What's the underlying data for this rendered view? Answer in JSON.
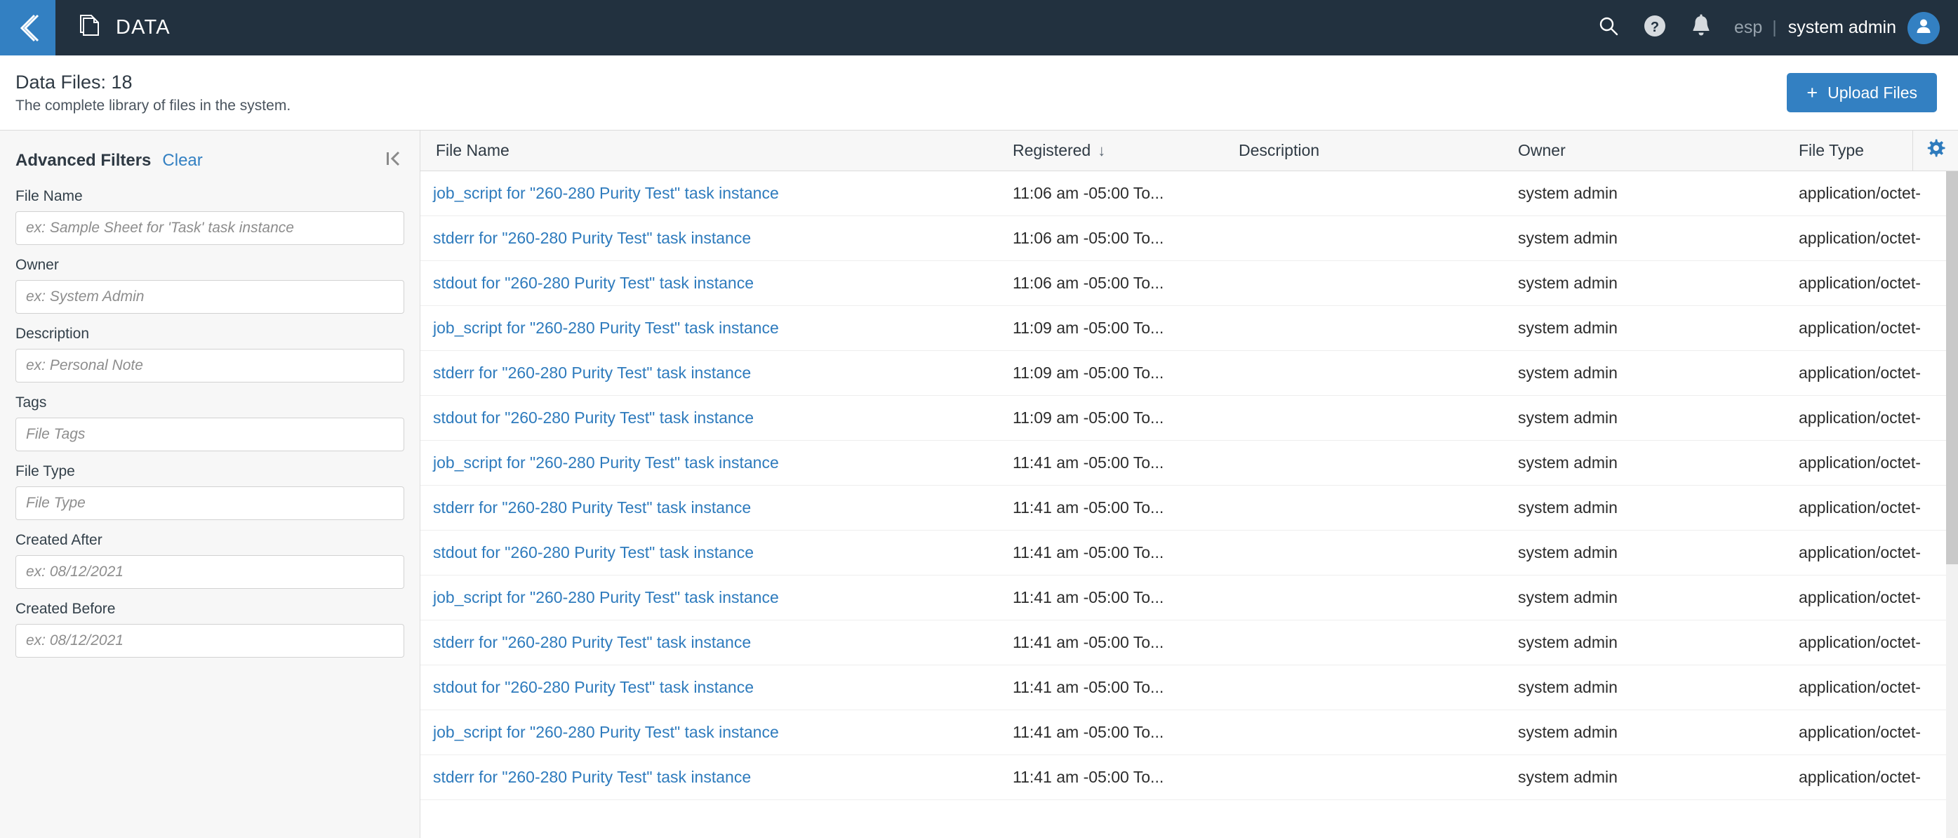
{
  "topnav": {
    "back_icon": "chevron-left-icon",
    "app_icon": "documents-stack-icon",
    "brand": "DATA",
    "search_icon": "search-icon",
    "help_icon": "help-circle-icon",
    "notifications_icon": "bell-icon",
    "tenant": "esp",
    "separator": "|",
    "username": "system admin",
    "avatar_icon": "user-avatar-icon",
    "background_color": "#22313f",
    "accent_color": "#3380c2"
  },
  "subheader": {
    "title": "Data Files: 18",
    "subtitle": "The complete library of files in the system.",
    "upload_button": {
      "plus": "+",
      "label": "Upload Files"
    }
  },
  "filters": {
    "title": "Advanced Filters",
    "clear_label": "Clear",
    "collapse_icon": "collapse-panel-left-icon",
    "fields": [
      {
        "label": "File Name",
        "placeholder": "ex: Sample Sheet for 'Task' task instance",
        "value": ""
      },
      {
        "label": "Owner",
        "placeholder": "ex: System Admin",
        "value": ""
      },
      {
        "label": "Description",
        "placeholder": "ex: Personal Note",
        "value": ""
      },
      {
        "label": "Tags",
        "placeholder": "File Tags",
        "value": ""
      },
      {
        "label": "File Type",
        "placeholder": "File Type",
        "value": ""
      },
      {
        "label": "Created After",
        "placeholder": "ex: 08/12/2021",
        "value": ""
      },
      {
        "label": "Created Before",
        "placeholder": "ex: 08/12/2021",
        "value": ""
      }
    ]
  },
  "table": {
    "columns": [
      {
        "key": "name",
        "label": "File Name",
        "sorted": false
      },
      {
        "key": "registered",
        "label": "Registered",
        "sorted": true,
        "sort_arrow": "↓"
      },
      {
        "key": "description",
        "label": "Description",
        "sorted": false
      },
      {
        "key": "owner",
        "label": "Owner",
        "sorted": false
      },
      {
        "key": "filetype",
        "label": "File Type",
        "sorted": false
      }
    ],
    "settings_icon": "gear-icon",
    "rows": [
      {
        "name": "job_script for \"260-280 Purity Test\" task instance",
        "registered": "11:06 am -05:00 To...",
        "description": "",
        "owner": "system admin",
        "filetype": "application/octet-st..."
      },
      {
        "name": "stderr for \"260-280 Purity Test\" task instance",
        "registered": "11:06 am -05:00 To...",
        "description": "",
        "owner": "system admin",
        "filetype": "application/octet-st..."
      },
      {
        "name": "stdout for \"260-280 Purity Test\" task instance",
        "registered": "11:06 am -05:00 To...",
        "description": "",
        "owner": "system admin",
        "filetype": "application/octet-st..."
      },
      {
        "name": "job_script for \"260-280 Purity Test\" task instance",
        "registered": "11:09 am -05:00 To...",
        "description": "",
        "owner": "system admin",
        "filetype": "application/octet-st..."
      },
      {
        "name": "stderr for \"260-280 Purity Test\" task instance",
        "registered": "11:09 am -05:00 To...",
        "description": "",
        "owner": "system admin",
        "filetype": "application/octet-st..."
      },
      {
        "name": "stdout for \"260-280 Purity Test\" task instance",
        "registered": "11:09 am -05:00 To...",
        "description": "",
        "owner": "system admin",
        "filetype": "application/octet-st..."
      },
      {
        "name": "job_script for \"260-280 Purity Test\" task instance",
        "registered": "11:41 am -05:00 To...",
        "description": "",
        "owner": "system admin",
        "filetype": "application/octet-st..."
      },
      {
        "name": "stderr for \"260-280 Purity Test\" task instance",
        "registered": "11:41 am -05:00 To...",
        "description": "",
        "owner": "system admin",
        "filetype": "application/octet-st..."
      },
      {
        "name": "stdout for \"260-280 Purity Test\" task instance",
        "registered": "11:41 am -05:00 To...",
        "description": "",
        "owner": "system admin",
        "filetype": "application/octet-st..."
      },
      {
        "name": "job_script for \"260-280 Purity Test\" task instance",
        "registered": "11:41 am -05:00 To...",
        "description": "",
        "owner": "system admin",
        "filetype": "application/octet-st..."
      },
      {
        "name": "stderr for \"260-280 Purity Test\" task instance",
        "registered": "11:41 am -05:00 To...",
        "description": "",
        "owner": "system admin",
        "filetype": "application/octet-st..."
      },
      {
        "name": "stdout for \"260-280 Purity Test\" task instance",
        "registered": "11:41 am -05:00 To...",
        "description": "",
        "owner": "system admin",
        "filetype": "application/octet-st..."
      },
      {
        "name": "job_script for \"260-280 Purity Test\" task instance",
        "registered": "11:41 am -05:00 To...",
        "description": "",
        "owner": "system admin",
        "filetype": "application/octet-st..."
      },
      {
        "name": "stderr for \"260-280 Purity Test\" task instance",
        "registered": "11:41 am -05:00 To...",
        "description": "",
        "owner": "system admin",
        "filetype": "application/octet-st..."
      }
    ]
  },
  "colors": {
    "nav_bg": "#22313f",
    "accent": "#3380c2",
    "link": "#2e7bbd",
    "panel_bg": "#f7f7f7",
    "border": "#dcdcdc"
  }
}
